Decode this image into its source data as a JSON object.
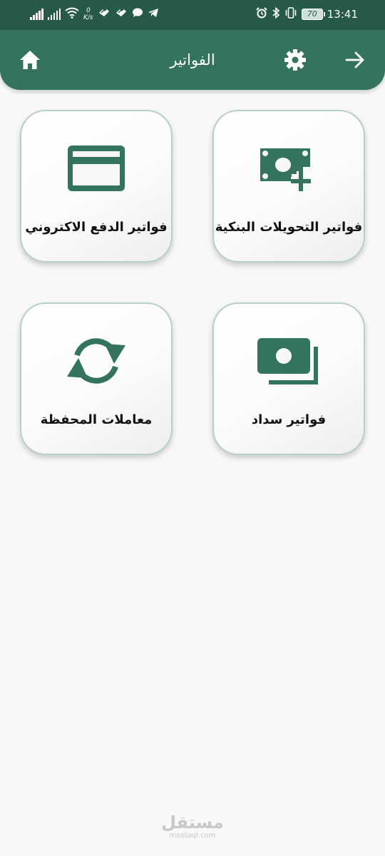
{
  "status_bar": {
    "speed_value": "0",
    "speed_unit": "K/s",
    "battery": "70",
    "time": "13:41",
    "icons": [
      "signal-icon",
      "signal-icon",
      "wifi-icon",
      "network-speed-icon",
      "app-notification-icon",
      "app-notification-icon",
      "chat-icon",
      "telegram-icon",
      "alarm-icon",
      "bluetooth-icon",
      "vibrate-icon",
      "battery-icon"
    ]
  },
  "app_bar": {
    "title": "الفواتير",
    "icons": [
      "home-icon",
      "gear-icon",
      "arrow-forward-icon"
    ]
  },
  "menu": {
    "items": [
      {
        "label": "فواتير التحويلات البنكية",
        "icon": "money-add-icon"
      },
      {
        "label": "فواتير الدفع الاكتروني",
        "icon": "credit-card-icon"
      },
      {
        "label": "فواتير سداد",
        "icon": "payments-icon"
      },
      {
        "label": "معاملات المحفظة",
        "icon": "sync-icon"
      }
    ]
  },
  "colors": {
    "primary": "#33735f",
    "status_bar": "#26594a",
    "card_border": "#b7d0c6",
    "background": "#f8f8f8"
  },
  "watermark": {
    "arabic": "مستقل",
    "latin": "mostaql.com"
  }
}
